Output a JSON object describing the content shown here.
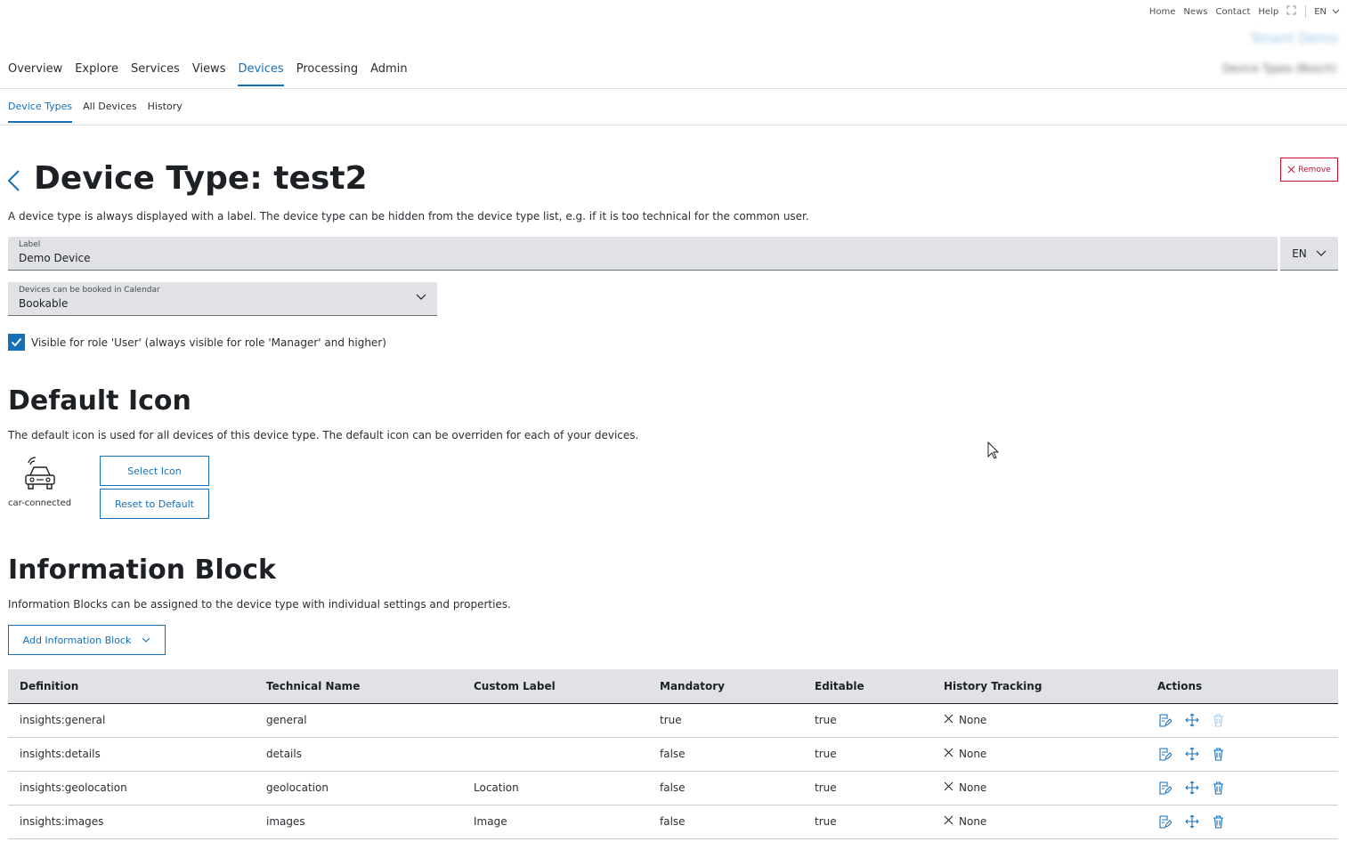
{
  "util_nav": {
    "links": [
      "Home",
      "News",
      "Contact",
      "Help"
    ],
    "language": "EN"
  },
  "brand": {
    "tenant": "Tenant Demo",
    "user": "Device Types (Bosch)"
  },
  "main_nav": {
    "items": [
      "Overview",
      "Explore",
      "Services",
      "Views",
      "Devices",
      "Processing",
      "Admin"
    ],
    "active": "Devices"
  },
  "sub_nav": {
    "items": [
      "Device Types",
      "All Devices",
      "History"
    ],
    "active": "Device Types"
  },
  "page": {
    "title": "Device Type: test2",
    "remove_label": "Remove",
    "description": "A device type is always displayed with a label. The device type can be hidden from the device type list, e.g. if it is too technical for the common user."
  },
  "label_field": {
    "label": "Label",
    "value": "Demo Device",
    "language": "EN"
  },
  "calendar_select": {
    "label": "Devices can be booked in Calendar",
    "value": "Bookable"
  },
  "visibility": {
    "checked": true,
    "text": "Visible for role 'User' (always visible for role 'Manager' and higher)"
  },
  "default_icon": {
    "title": "Default Icon",
    "description": "The default icon is used for all devices of this device type. The default icon can be overriden for each of your devices.",
    "icon_name": "car-connected",
    "select_label": "Select Icon",
    "reset_label": "Reset to Default"
  },
  "info_block": {
    "title": "Information Block",
    "description": "Information Blocks can be assigned to the device type with individual settings and properties.",
    "add_label": "Add Information Block",
    "columns": [
      "Definition",
      "Technical Name",
      "Custom Label",
      "Mandatory",
      "Editable",
      "History Tracking",
      "Actions"
    ],
    "rows": [
      {
        "definition": "insights:general",
        "technical_name": "general",
        "custom_label": "",
        "mandatory": "true",
        "editable": "true",
        "history": "None",
        "delete_disabled": true
      },
      {
        "definition": "insights:details",
        "technical_name": "details",
        "custom_label": "",
        "mandatory": "false",
        "editable": "true",
        "history": "None",
        "delete_disabled": false
      },
      {
        "definition": "insights:geolocation",
        "technical_name": "geolocation",
        "custom_label": "Location",
        "mandatory": "false",
        "editable": "true",
        "history": "None",
        "delete_disabled": false
      },
      {
        "definition": "insights:images",
        "technical_name": "images",
        "custom_label": "Image",
        "mandatory": "false",
        "editable": "true",
        "history": "None",
        "delete_disabled": false
      }
    ]
  },
  "colors": {
    "accent": "#1570b8",
    "danger": "#c8102e",
    "field_bg": "#e0e2e5"
  }
}
